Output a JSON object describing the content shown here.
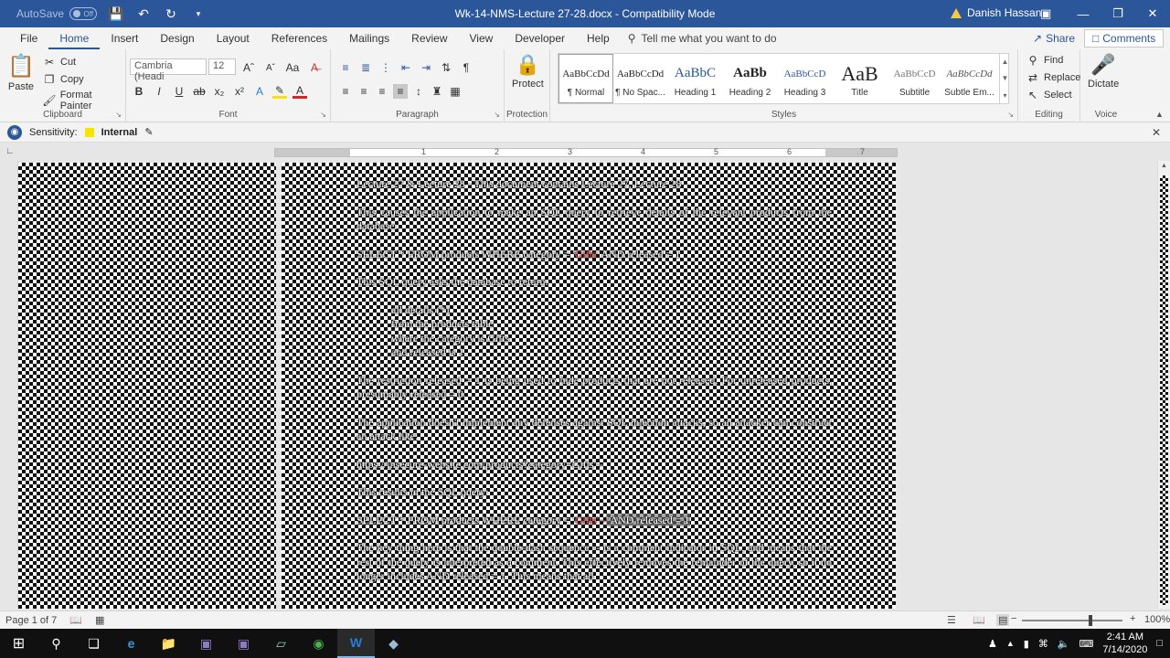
{
  "titlebar": {
    "autosave_label": "AutoSave",
    "autosave_state": "Off",
    "doc_title": "Wk-14-NMS-Lecture 27-28.docx  -  Compatibility Mode",
    "user_name": "Danish Hassan"
  },
  "menu": {
    "tabs": [
      "File",
      "Home",
      "Insert",
      "Design",
      "Layout",
      "References",
      "Mailings",
      "Review",
      "View",
      "Developer",
      "Help"
    ],
    "tell_me": "Tell me what you want to do",
    "share": "Share",
    "comments": "Comments"
  },
  "ribbon": {
    "clipboard": {
      "paste": "Paste",
      "cut": "Cut",
      "copy": "Copy",
      "format_painter": "Format Painter",
      "label": "Clipboard"
    },
    "font": {
      "family": "Cambria (Headi",
      "size": "12",
      "label": "Font"
    },
    "paragraph": {
      "label": "Paragraph"
    },
    "protection": {
      "protect": "Protect",
      "label": "Protection"
    },
    "styles": {
      "label": "Styles",
      "items": [
        {
          "preview": "AaBbCcDd",
          "name": "¶ Normal"
        },
        {
          "preview": "AaBbCcDd",
          "name": "¶ No Spac..."
        },
        {
          "preview": "AaBbC",
          "name": "Heading 1"
        },
        {
          "preview": "AaBb",
          "name": "Heading 2"
        },
        {
          "preview": "AaBbCcD",
          "name": "Heading 3"
        },
        {
          "preview": "AaB",
          "name": "Title"
        },
        {
          "preview": "AaBbCcD",
          "name": "Subtitle"
        },
        {
          "preview": "AaBbCcDd",
          "name": "Subtle Em..."
        }
      ]
    },
    "editing": {
      "find": "Find",
      "replace": "Replace",
      "select": "Select",
      "label": "Editing"
    },
    "voice": {
      "dictate": "Dictate",
      "label": "Voice"
    }
  },
  "sensitivity": {
    "label": "Sensitivity:",
    "value": "Internal"
  },
  "document": {
    "line1": "Lecture 27 & Lecture 28 - This document contains Lecture 27, Lecture 28",
    "p1": "This causes the application to make an SQL query to retrieve details of the relevant products from the database:",
    "q1_pre": "SELECT * FROM products WHERE category = '",
    "q1_cat": "Gifts",
    "q1_post": "' AND released = 1",
    "p2": "This SQL query asks the database to return:",
    "b1": "all details (*)",
    "b2": "from the products table",
    "b3": "where the category is Gifts",
    "b4": "and released is 1.",
    "p3": "The restriction released = 1 is being used to hide products that are not released. For unreleased products, presumably released = 0.",
    "p4": "The application doesn't implement any defenses against SQL injection attacks, so an attacker can construct an attack like:",
    "url": "https://insecure-website.com/products?category=Gifts'--",
    "p5": "This results in the SQL query:",
    "q2_pre": "SELECT * FROM products WHERE category = '",
    "q2_cat": "Gifts'--",
    "q2_post": "' AND released = 1",
    "p6": "The key thing here is that the double-dash sequence -- is a comment indicator in SQL, and means that the rest of the query is interpreted as a comment. This effectively removes the remainder of the query, so it no longer includes AND released = 1. This means that all"
  },
  "statusbar": {
    "page": "Page 1 of 7",
    "zoom": "100%",
    "zoom_level_percent": 100
  },
  "taskbar": {
    "time": "2:41 AM",
    "date": "7/14/2020"
  }
}
